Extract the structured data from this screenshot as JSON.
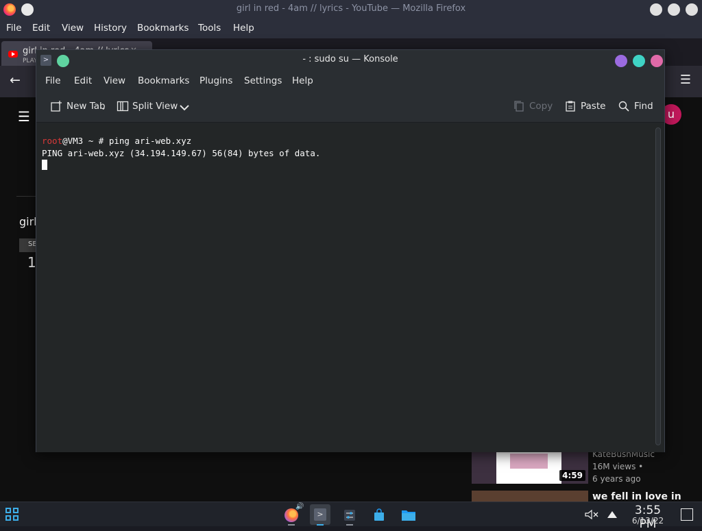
{
  "firefox": {
    "window_title": "girl in red - 4am // lyrics - YouTube — Mozilla Firefox",
    "menu": [
      "File",
      "Edit",
      "View",
      "History",
      "Bookmarks",
      "Tools",
      "Help"
    ],
    "tab": {
      "title": "girl in red - 4am // lyrics",
      "subtitle": "PLAYING",
      "close": "×"
    },
    "back_icon": "←",
    "menu_icon": "☰"
  },
  "youtube": {
    "menu_icon": "☰",
    "avatar_letter": "u",
    "video_title_partial": "girl",
    "chip_partial": "SE",
    "count_partial": "1",
    "recommendations": [
      {
        "channel": "KateBushMusic",
        "views": "16M views •",
        "age": "6 years ago",
        "duration": "4:59"
      },
      {
        "title": "we fell in love in"
      }
    ]
  },
  "konsole": {
    "window_title": "- : sudo su — Konsole",
    "app_icon": ">",
    "menu": [
      "File",
      "Edit",
      "View",
      "Bookmarks",
      "Plugins",
      "Settings",
      "Help"
    ],
    "toolbar": {
      "new_tab": "New Tab",
      "split_view": "Split View",
      "copy": "Copy",
      "paste": "Paste",
      "find": "Find"
    },
    "terminal": {
      "prompt_user": "root",
      "prompt_rest": "@VM3 ~ # ping ari-web.xyz",
      "output_line": "PING ari-web.xyz (34.194.149.67) 56(84) bytes of data."
    },
    "colors": {
      "prompt_user": "#d93939",
      "keep_above": "#5fd3a0",
      "minimize": "#9b6be0",
      "maximize": "#3fd3c4",
      "close": "#e06aa8"
    }
  },
  "taskbar": {
    "time": "3:55 PM",
    "date": "6/13/22",
    "tray": {
      "volume_icon": "🔇",
      "expand_icon": "▲"
    }
  }
}
